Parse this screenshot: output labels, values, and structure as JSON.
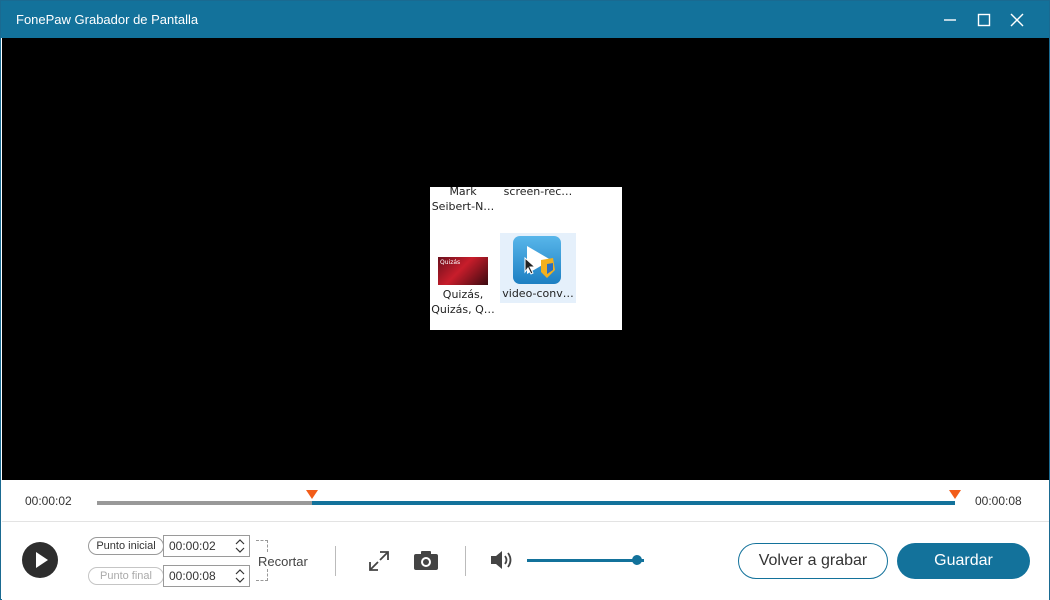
{
  "window": {
    "title": "FonePaw Grabador de Pantalla"
  },
  "preview": {
    "files": [
      {
        "label": "Mark\nSeibert-N…",
        "icon": "file-icon"
      },
      {
        "label": "screen-rec…",
        "icon": "file-icon"
      },
      {
        "label": "Quizás,\nQuizás, Q…",
        "icon": "video-thumbnail",
        "thumb_text": "Quizás"
      },
      {
        "label": "video-conv…",
        "icon": "video-converter-app-icon"
      }
    ]
  },
  "timeline": {
    "current_time": "00:00:02",
    "total_time": "00:00:08",
    "start_fraction": 0.25,
    "end_fraction": 1.0
  },
  "controls": {
    "start_point_label": "Punto inicial",
    "start_point_value": "00:00:02",
    "end_point_label": "Punto final",
    "end_point_value": "00:00:08",
    "trim_label": "Recortar",
    "volume_level": 0.94,
    "rerecord_label": "Volver a grabar",
    "save_label": "Guardar"
  },
  "colors": {
    "accent": "#13729b",
    "marker": "#f25c19",
    "preview_bg": "#000000"
  }
}
